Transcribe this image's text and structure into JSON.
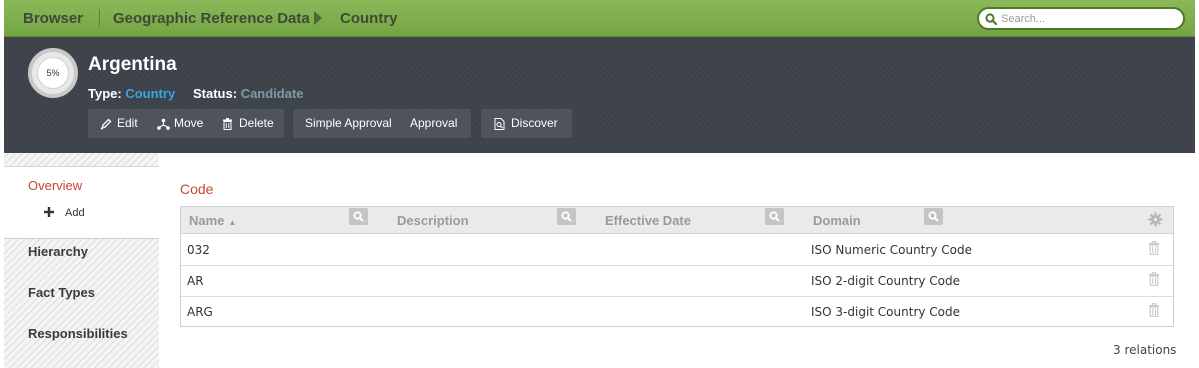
{
  "topbar": {
    "breadcrumb": [
      "Browser",
      "Geographic Reference Data",
      "Country"
    ],
    "search_placeholder": "Search..."
  },
  "asset": {
    "progress_label": "5%",
    "progress_value": 0.05,
    "title": "Argentina",
    "type_label": "Type:",
    "type_value": "Country",
    "status_label": "Status:",
    "status_value": "Candidate"
  },
  "actions": {
    "edit": "Edit",
    "move": "Move",
    "delete": "Delete",
    "simple_approval": "Simple Approval",
    "approval": "Approval",
    "discover": "Discover"
  },
  "sidebar": {
    "overview": "Overview",
    "add": "Add",
    "hierarchy": "Hierarchy",
    "fact_types": "Fact Types",
    "responsibilities": "Responsibilities"
  },
  "section": {
    "title": "Code"
  },
  "table": {
    "columns": [
      "Name",
      "Description",
      "Effective Date",
      "Domain"
    ],
    "rows": [
      {
        "name": "032",
        "description": "",
        "effective_date": "",
        "domain": "ISO Numeric Country Code"
      },
      {
        "name": "AR",
        "description": "",
        "effective_date": "",
        "domain": "ISO 2-digit Country Code"
      },
      {
        "name": "ARG",
        "description": "",
        "effective_date": "",
        "domain": "ISO 3-digit Country Code"
      }
    ],
    "count_label": "3 relations"
  },
  "colors": {
    "topbar": "#7eae4d",
    "header_bg": "#3f444c",
    "accent_red": "#c6472d",
    "link_blue": "#35a7e0"
  }
}
